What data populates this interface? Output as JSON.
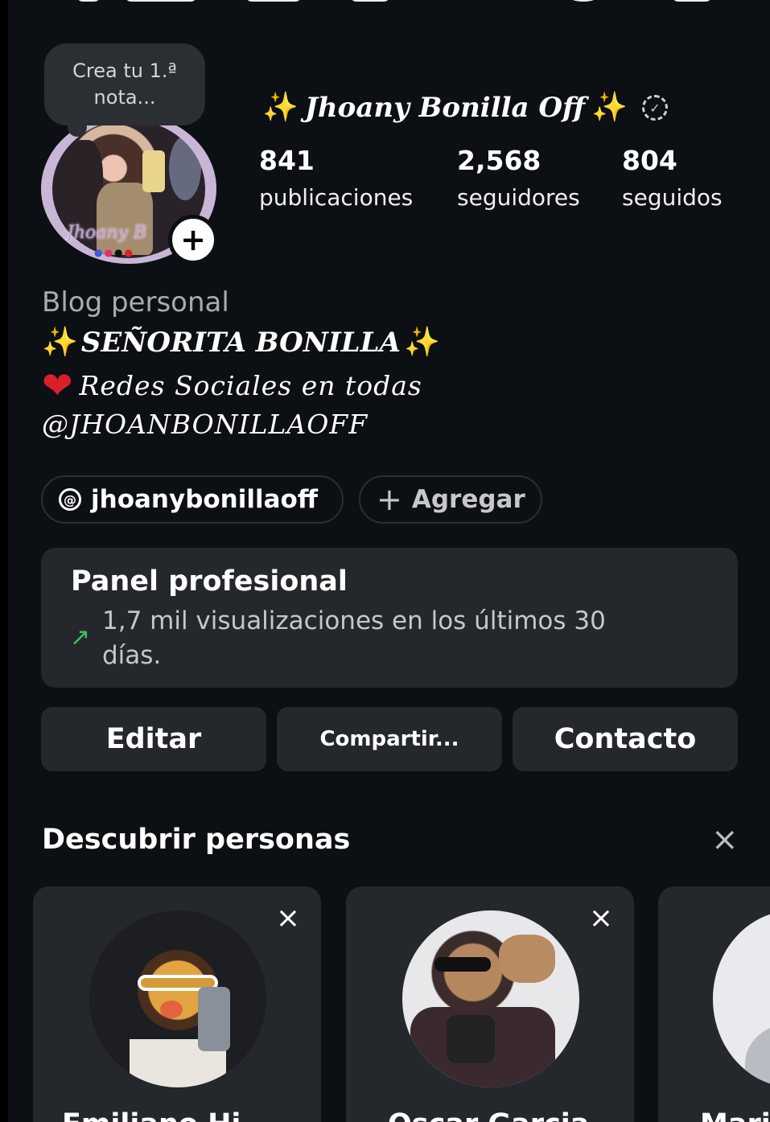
{
  "note": {
    "line1": "Crea tu 1.ª",
    "line2": "nota..."
  },
  "profile": {
    "name": "Jhoany Bonilla Off",
    "sparkle_left": "✨",
    "sparkle_right": "✨",
    "verified_icon": "✓"
  },
  "stats": [
    {
      "value": "841",
      "label": "publicaciones"
    },
    {
      "value": "2,568",
      "label": "seguidores"
    },
    {
      "value": "804",
      "label": "seguidos"
    }
  ],
  "bio": {
    "category": "Blog personal",
    "line1": "SEÑORITA BONILLA",
    "line1_sparkle": "✨",
    "line2_heart": "❤",
    "line2": "Redes Sociales en todas",
    "line3": "@JHOANBONILLAOFF"
  },
  "avatar": {
    "signature": "Jhoany B"
  },
  "chips": {
    "threads_label": "jhoanybonillaoff",
    "threads_icon": "@",
    "add_label": "Agregar",
    "add_icon": "+"
  },
  "dashboard": {
    "title": "Panel profesional",
    "arrow_icon": "↗",
    "subtitle": "1,7 mil visualizaciones en los últimos 30 días."
  },
  "actions": {
    "edit": "Editar",
    "share": "Compartir...",
    "contact": "Contacto"
  },
  "discover": {
    "title": "Descubrir personas",
    "close_icon": "×",
    "cards": [
      {
        "name": "Emiliano Hi...",
        "close_icon": "×"
      },
      {
        "name": "Oscar Garcia",
        "close_icon": "×"
      },
      {
        "name": "Mari..."
      }
    ]
  },
  "colors": {
    "background": "#0c0f14",
    "card": "#24272c",
    "accent_green": "#3fbf5b",
    "sparkle": "#f6d245",
    "heart": "#d9202a"
  }
}
